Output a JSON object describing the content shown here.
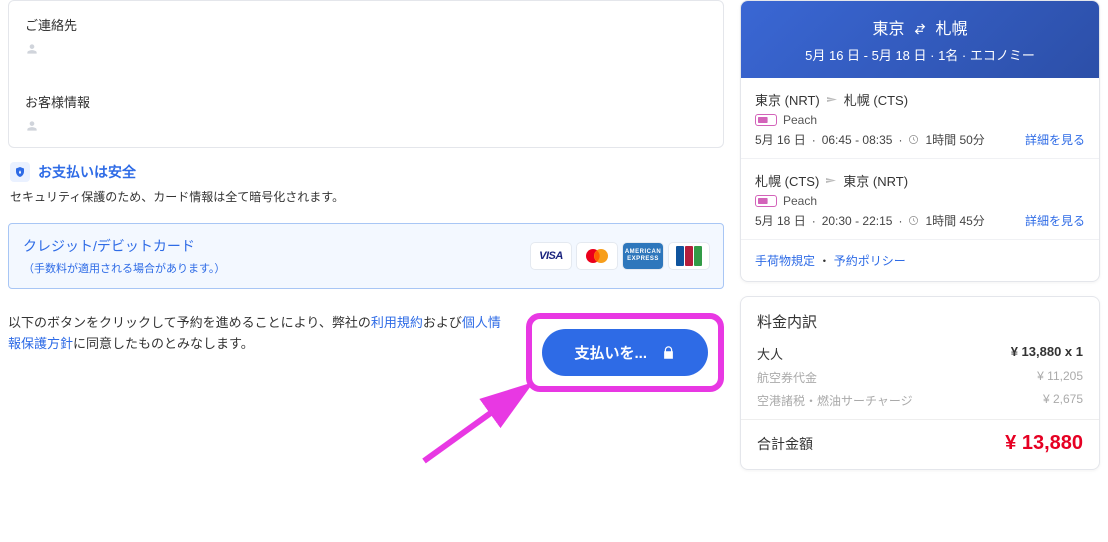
{
  "left": {
    "contact_heading": "ご連絡先",
    "customer_heading": "お客様情報",
    "secure_title": "お支払いは安全",
    "secure_subtitle": "セキュリティ保護のため、カード情報は全て暗号化されます。",
    "payment_method": {
      "label": "クレジット/デビットカード",
      "note": "（手数料が適用される場合があります。）",
      "brands": [
        "VISA",
        "Mastercard",
        "AMERICAN EXPRESS",
        "JCB"
      ]
    },
    "terms": {
      "prefix": "以下のボタンをクリックして予約を進めることにより、弊社の",
      "link1": "利用規約",
      "middle": "および",
      "link2": "個人情報保護方針",
      "suffix": "に同意したものとみなします。"
    },
    "pay_button": "支払いを..."
  },
  "itinerary": {
    "origin": "東京",
    "destination": "札幌",
    "meta": "5月 16 日 - 5月 18 日 · 1名 · エコノミー",
    "segments": [
      {
        "from": "東京 (NRT)",
        "to": "札幌 (CTS)",
        "airline": "Peach",
        "date": "5月 16 日",
        "times": "06:45 - 08:35",
        "duration": "1時間 50分",
        "detail_link": "詳細を見る"
      },
      {
        "from": "札幌 (CTS)",
        "to": "東京 (NRT)",
        "airline": "Peach",
        "date": "5月 18 日",
        "times": "20:30 - 22:15",
        "duration": "1時間 45分",
        "detail_link": "詳細を見る"
      }
    ],
    "baggage_link": "手荷物規定",
    "policy_sep": " ・ ",
    "policy_link": "予約ポリシー"
  },
  "price": {
    "title": "料金内訳",
    "rows": [
      {
        "label": "大人",
        "value": "¥ 13,880 x 1",
        "sub": false
      },
      {
        "label": "航空券代金",
        "value": "¥ 11,205",
        "sub": true
      },
      {
        "label": "空港諸税・燃油サーチャージ",
        "value": "¥ 2,675",
        "sub": true
      }
    ],
    "total_label": "合計金額",
    "total_value": "¥ 13,880"
  }
}
